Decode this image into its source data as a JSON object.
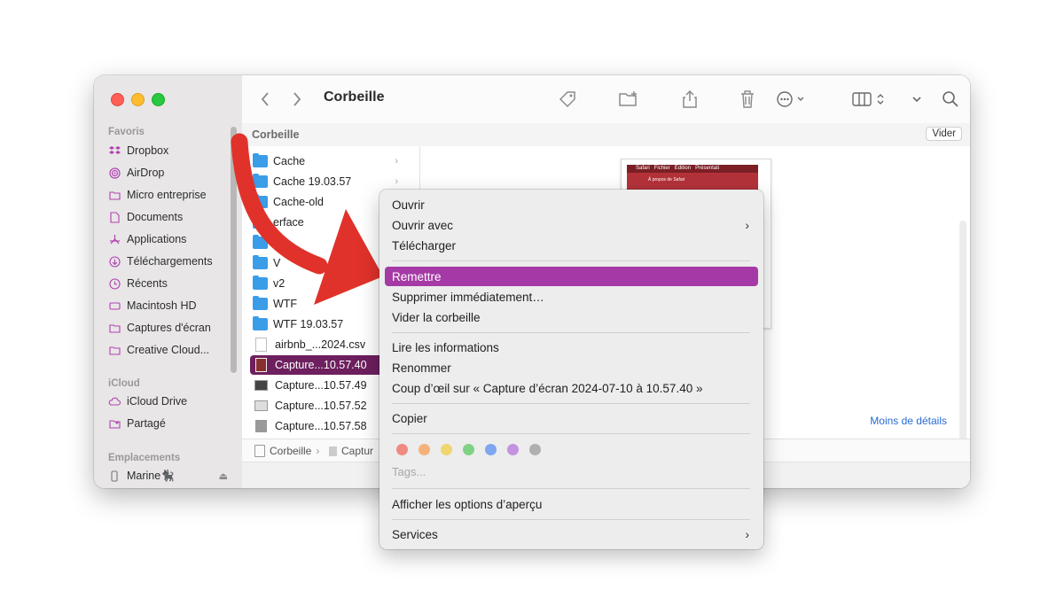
{
  "window": {
    "title": "Corbeille",
    "path_header": "Corbeille",
    "empty_button": "Vider"
  },
  "sidebar": {
    "favorites_header": "Favoris",
    "favorites": [
      {
        "label": "Dropbox",
        "icon": "dropbox-icon"
      },
      {
        "label": "AirDrop",
        "icon": "airdrop-icon"
      },
      {
        "label": "Micro entreprise",
        "icon": "folder-icon"
      },
      {
        "label": "Documents",
        "icon": "document-icon"
      },
      {
        "label": "Applications",
        "icon": "applications-icon"
      },
      {
        "label": "Téléchargements",
        "icon": "download-icon"
      },
      {
        "label": "Récents",
        "icon": "clock-icon"
      },
      {
        "label": "Macintosh HD",
        "icon": "disk-icon"
      },
      {
        "label": "Captures d'écran",
        "icon": "folder-icon"
      },
      {
        "label": "Creative Cloud...",
        "icon": "folder-icon"
      }
    ],
    "icloud_header": "iCloud",
    "icloud": [
      {
        "label": "iCloud Drive",
        "icon": "cloud-icon"
      },
      {
        "label": "Partagé",
        "icon": "shared-folder-icon"
      }
    ],
    "locations_header": "Emplacements",
    "locations": [
      {
        "label": "Marine🐈‍⬛",
        "icon": "phone-icon"
      }
    ]
  },
  "files": [
    {
      "name": "Cache",
      "type": "folder"
    },
    {
      "name": "Cache 19.03.57",
      "type": "folder"
    },
    {
      "name": "Cache-old",
      "type": "folder"
    },
    {
      "name": "erface",
      "type": "folder"
    },
    {
      "name": "",
      "type": "folder"
    },
    {
      "name": "V",
      "type": "folder"
    },
    {
      "name": "v2",
      "type": "folder"
    },
    {
      "name": "WTF",
      "type": "folder"
    },
    {
      "name": "WTF 19.03.57",
      "type": "folder"
    },
    {
      "name": "airbnb_...2024.csv",
      "type": "doc"
    },
    {
      "name": "Capture...10.57.40",
      "type": "shot",
      "selected": true
    },
    {
      "name": "Capture...10.57.49",
      "type": "shot"
    },
    {
      "name": "Capture...10.57.52",
      "type": "shot"
    },
    {
      "name": "Capture...10.57.58",
      "type": "shot"
    }
  ],
  "preview": {
    "less_details": "Moins de détails",
    "thumb_menu": [
      "Safari",
      "Fichier",
      "Édition",
      "Présentati"
    ],
    "thumb_item": "À propos de Safari"
  },
  "statusbar": {
    "crumbs": [
      "Corbeille",
      "Captur"
    ]
  },
  "context_menu": {
    "items": [
      {
        "label": "Ouvrir"
      },
      {
        "label": "Ouvrir avec",
        "submenu": true
      },
      {
        "label": "Télécharger"
      },
      {
        "label": "Remettre",
        "highlighted": true
      },
      {
        "label": "Supprimer immédiatement…"
      },
      {
        "label": "Vider la corbeille"
      },
      {
        "label": "Lire les informations"
      },
      {
        "label": "Renommer"
      },
      {
        "label": "Coup d’œil sur « Capture d’écran 2024-07-10 à 10.57.40 »"
      },
      {
        "label": "Copier"
      },
      {
        "label": "Afficher les options d’aperçu"
      },
      {
        "label": "Services",
        "submenu": true
      }
    ],
    "tags_placeholder": "Tags...",
    "tag_colors": [
      "#f08a80",
      "#f4b27a",
      "#f1d56e",
      "#7fd285",
      "#7fa7f0",
      "#c393e0",
      "#b0b0b0"
    ]
  },
  "colors": {
    "highlight": "#a53aa6",
    "selection": "#6d1f5e",
    "arrow": "#e0322b"
  }
}
